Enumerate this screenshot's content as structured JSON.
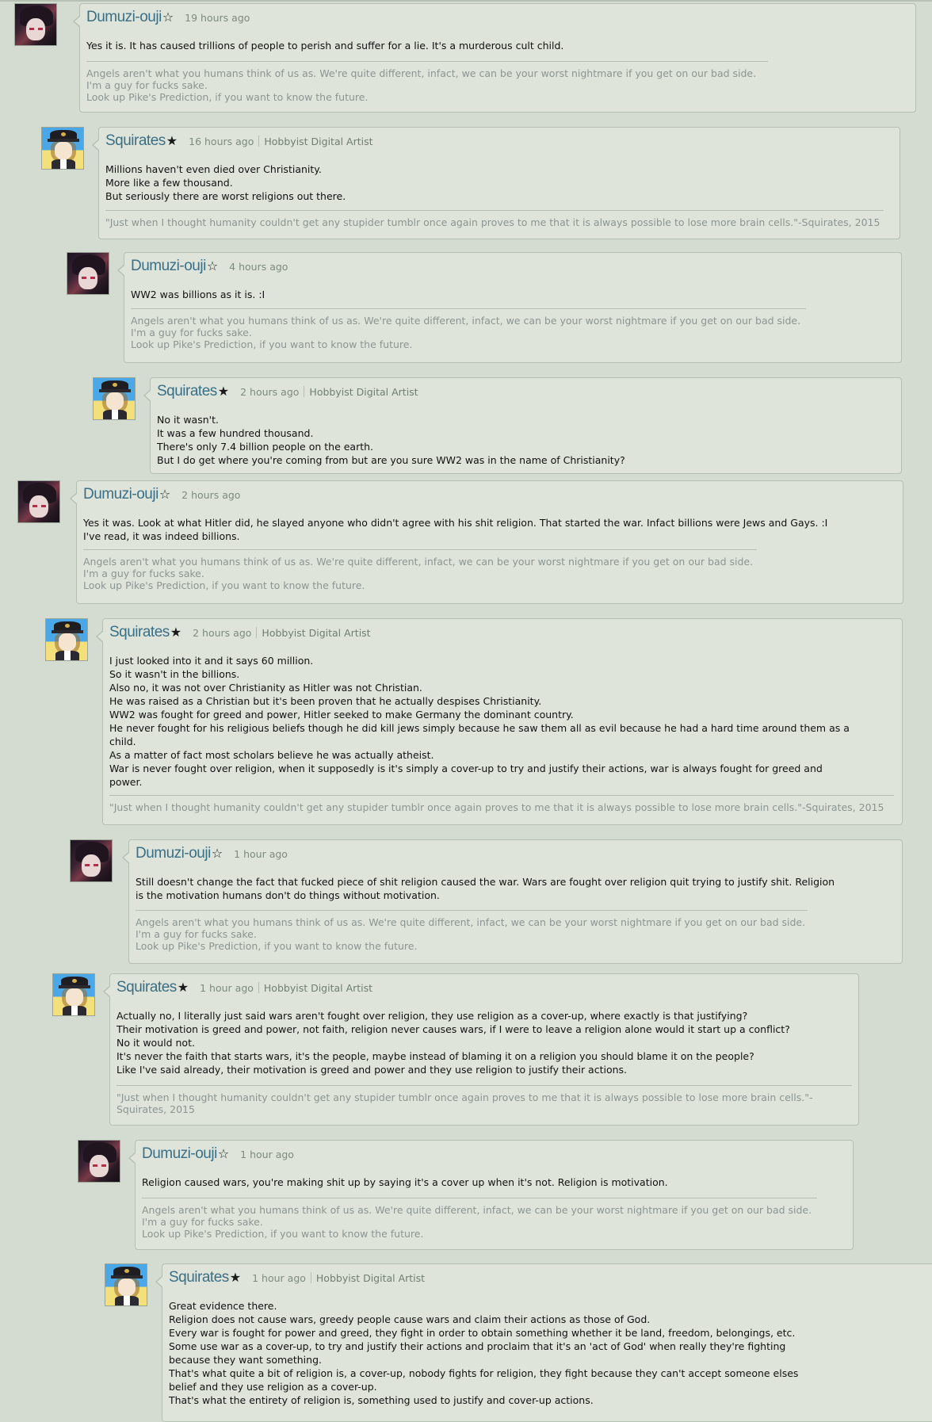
{
  "users": {
    "dumuzi": {
      "name": "Dumuzi-ouji",
      "star": "☆",
      "avatar_icon": "dark-haired-avatar-icon"
    },
    "squirates": {
      "name": "Squirates",
      "star": "★",
      "role": "Hobbyist Digital Artist",
      "avatar_icon": "officer-hat-avatar-icon"
    }
  },
  "signatures": {
    "dumuzi": [
      "Angels aren't what you humans think of us as. We're quite different, infact, we can be your worst nightmare if you get on our bad side.",
      "I'm a guy for fucks sake.",
      "Look up Pike's Prediction, if you want to know the future."
    ],
    "squirates": [
      "\"Just when I thought humanity couldn't get any stupider tumblr once again proves to me that it is always possible to lose more brain cells.\"-Squirates, 2015"
    ],
    "squirates_wrapped": [
      "\"Just when I thought humanity couldn't get any stupider tumblr once again proves to me that it is always possible to lose more brain cells.\"-",
      "Squirates, 2015"
    ]
  },
  "comments": [
    {
      "time": "19 hours ago",
      "lines": [
        "Yes it is. It has caused trillions of people to perish and suffer for a lie. It's a murderous cult child."
      ]
    },
    {
      "time": "16 hours ago",
      "lines": [
        "Millions haven't even died over Christianity.",
        "More like a few thousand.",
        "But seriously there are worst religions out there."
      ]
    },
    {
      "time": "4 hours ago",
      "lines": [
        "WW2 was billions as it is. :I"
      ]
    },
    {
      "time": "2 hours ago",
      "lines": [
        "No it wasn't.",
        "It was a few hundred thousand.",
        "There's only 7.4 billion people on the earth.",
        "But I do get where you're coming from but are you sure WW2 was in the name of Christianity?"
      ]
    },
    {
      "time": "2 hours ago",
      "lines": [
        "Yes it was. Look at what Hitler did, he slayed anyone who didn't agree with his shit religion. That started the war. Infact billions were Jews and Gays. :I",
        "I've read, it was indeed billions."
      ]
    },
    {
      "time": "2 hours ago",
      "lines": [
        "I just looked into it and it says 60 million.",
        "So it wasn't in the billions.",
        "Also no, it was not over Christianity as Hitler was not Christian.",
        "He was raised as a Christian but it's been proven that he actually despises Christianity.",
        "WW2 was fought for greed and power, Hitler seeked to make Germany the dominant country.",
        "He never fought for his religious beliefs though he did kill jews simply because he saw them all as evil because he had a hard time around them as a",
        "child.",
        "As a matter of fact most scholars believe he was actually atheist.",
        "War is never fought over religion, when it supposedly is it's simply a cover-up to try and justify their actions, war is always fought for greed and",
        "power."
      ]
    },
    {
      "time": "1 hour ago",
      "lines": [
        "Still doesn't change the fact that fucked piece of shit religion caused the war. Wars are fought over religion quit trying to justify shit.  Religion",
        "is the motivation humans don't do things without motivation."
      ]
    },
    {
      "time": "1 hour ago",
      "lines": [
        "Actually no, I literally just said wars aren't fought over religion, they use religion as a cover-up, where exactly is that justifying?",
        "Their motivation is greed and power, not faith, religion never causes wars, if I were to leave a religion alone would it start up a conflict?",
        "No it would not.",
        "It's never the faith that starts wars, it's the people, maybe instead of blaming it on a religion you should blame it on the people?",
        "Like I've said already, their motivation is greed and power and they use religion to justify their actions."
      ]
    },
    {
      "time": "1 hour ago",
      "lines": [
        "Religion caused wars, you're making shit up by saying it's a cover up when it's not. Religion is motivation."
      ]
    },
    {
      "time": "1 hour ago",
      "lines": [
        "Great evidence there.",
        "Religion does not cause wars, greedy people cause wars and claim their actions as those of God.",
        "Every war is fought for power and greed, they fight in order to obtain something whether it be land, freedom, belongings, etc.",
        "Some use war as a cover-up, to try and justify their actions and proclaim that it's an 'act of God' when really they're fighting",
        "because they want something.",
        "That's what quite a bit of religion is, a cover-up, nobody fights for religion, they fight because they can't accept someone elses",
        "belief and they use religion as a cover-up.",
        "That's what the entirety of religion is, something used to justify and cover-up actions."
      ]
    }
  ]
}
